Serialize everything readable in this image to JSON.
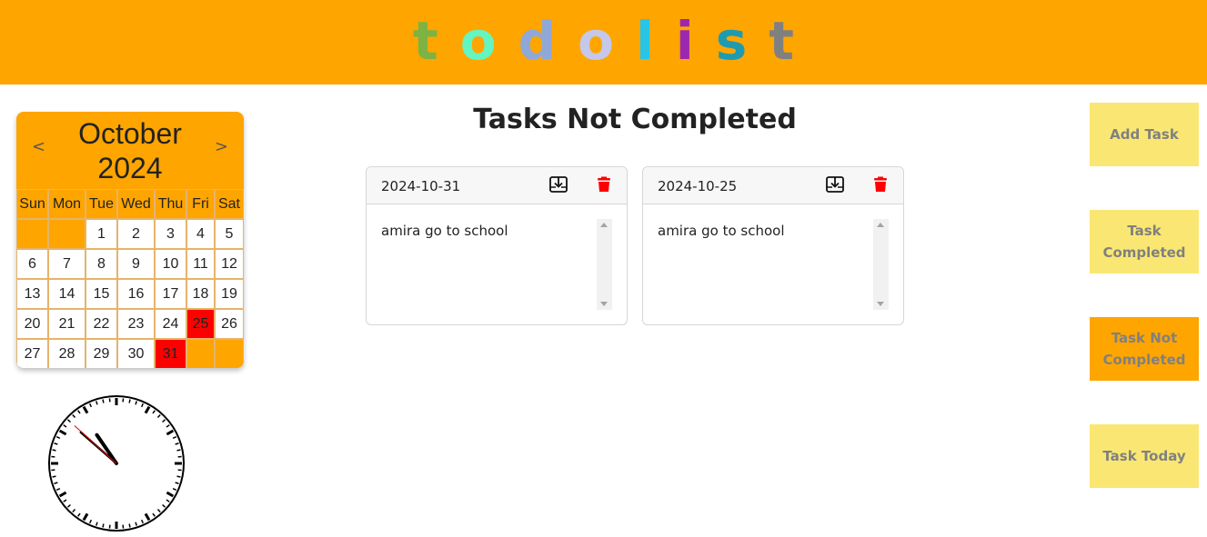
{
  "header": {
    "logo_letters": [
      {
        "char": "t",
        "color": "#7cb342"
      },
      {
        "char": "o",
        "color": "#64f5c0"
      },
      {
        "char": "d",
        "color": "#8fa8d8"
      },
      {
        "char": "o",
        "color": "#c5c8e8"
      },
      {
        "char": "l",
        "color": "#29c5e6"
      },
      {
        "char": "i",
        "color": "#9c27b0"
      },
      {
        "char": "s",
        "color": "#1e9bb0"
      },
      {
        "char": "t",
        "color": "#808080"
      }
    ],
    "background": "#FFA500"
  },
  "calendar": {
    "month": "October",
    "year": "2024",
    "prev_label": "<",
    "next_label": ">",
    "weekdays": [
      "Sun",
      "Mon",
      "Tue",
      "Wed",
      "Thu",
      "Fri",
      "Sat"
    ],
    "weeks": [
      [
        "",
        "",
        "1",
        "2",
        "3",
        "4",
        "5"
      ],
      [
        "6",
        "7",
        "8",
        "9",
        "10",
        "11",
        "12"
      ],
      [
        "13",
        "14",
        "15",
        "16",
        "17",
        "18",
        "19"
      ],
      [
        "20",
        "21",
        "22",
        "23",
        "24",
        "25",
        "26"
      ],
      [
        "27",
        "28",
        "29",
        "30",
        "31",
        "",
        ""
      ]
    ],
    "highlighted_days": [
      "25",
      "31"
    ],
    "highlight_color": "#ff0000"
  },
  "clock": {
    "time_shown": "10:51:52"
  },
  "main": {
    "title": "Tasks Not Completed",
    "tasks": [
      {
        "date": "2024-10-31",
        "text": "amira go to school"
      },
      {
        "date": "2024-10-25",
        "text": "amira go to school"
      }
    ]
  },
  "sidebar": {
    "buttons": [
      {
        "label": "Add Task",
        "bg": "#FAE773",
        "active": false
      },
      {
        "label": "Task Completed",
        "bg": "#FAE773",
        "active": false
      },
      {
        "label": "Task Not Completed",
        "bg": "#FFA500",
        "active": true
      },
      {
        "label": "Task Today",
        "bg": "#FAE773",
        "active": false
      }
    ]
  }
}
